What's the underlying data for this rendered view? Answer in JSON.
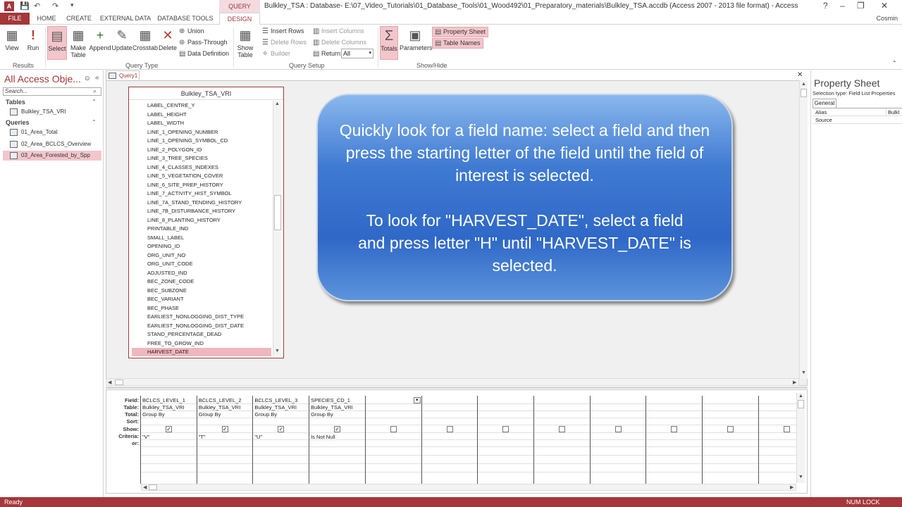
{
  "window": {
    "title": "Bulkley_TSA : Database- E:\\07_Video_Tutorials\\01_Database_Tools\\01_Wood492\\01_Preparatory_materials\\Bulkley_TSA.accdb (Access 2007 - 2013 file format) - Access",
    "contextual_tab": "QUERY TOOLS",
    "user": "Cosmin"
  },
  "tabs": [
    "FILE",
    "HOME",
    "CREATE",
    "EXTERNAL DATA",
    "DATABASE TOOLS",
    "DESIGN"
  ],
  "ribbon": {
    "results": {
      "label": "Results",
      "view": "View",
      "run": "Run"
    },
    "query_type": {
      "label": "Query Type",
      "select": "Select",
      "make_table": "Make Table",
      "append": "Append",
      "update": "Update",
      "crosstab": "Crosstab",
      "delete": "Delete",
      "union": "Union",
      "pass_through": "Pass-Through",
      "data_definition": "Data Definition"
    },
    "query_setup": {
      "label": "Query Setup",
      "show_table": "Show Table",
      "insert_rows": "Insert Rows",
      "delete_rows": "Delete Rows",
      "builder": "Builder",
      "insert_columns": "Insert Columns",
      "delete_columns": "Delete Columns",
      "return_label": "Return:",
      "return_value": "All"
    },
    "show_hide": {
      "label": "Show/Hide",
      "totals": "Totals",
      "parameters": "Parameters",
      "property_sheet": "Property Sheet",
      "table_names": "Table Names"
    }
  },
  "nav": {
    "title": "All Access Obje...",
    "search_placeholder": "Search...",
    "tables_header": "Tables",
    "tables": [
      "Bulkley_TSA_VRI"
    ],
    "queries_header": "Queries",
    "queries": [
      "01_Area_Total",
      "02_Area_BCLCS_Overview",
      "03_Area_Forested_by_Spp"
    ]
  },
  "document": {
    "tab": "Query1"
  },
  "field_list": {
    "title": "Bulkley_TSA_VRI",
    "fields": [
      "LABEL_CENTRE_Y",
      "LABEL_HEIGHT",
      "LABEL_WIDTH",
      "LINE_1_OPENING_NUMBER",
      "LINE_1_OPENING_SYMBOL_CD",
      "LINE_2_POLYGON_ID",
      "LINE_3_TREE_SPECIES",
      "LINE_4_CLASSES_INDEXES",
      "LINE_5_VEGETATION_COVER",
      "LINE_6_SITE_PREP_HISTORY",
      "LINE_7_ACTIVITY_HIST_SYMBOL",
      "LINE_7A_STAND_TENDING_HISTORY",
      "LINE_7B_DISTURBANCE_HISTORY",
      "LINE_8_PLANTING_HISTORY",
      "PRINTABLE_IND",
      "SMALL_LABEL",
      "OPENING_ID",
      "ORG_UNIT_NO",
      "ORG_UNIT_CODE",
      "ADJUSTED_IND",
      "BEC_ZONE_CODE",
      "BEC_SUBZONE",
      "BEC_VARIANT",
      "BEC_PHASE",
      "EARLIEST_NONLOGGING_DIST_TYPE",
      "EARLIEST_NONLOGGING_DIST_DATE",
      "STAND_PERCENTAGE_DEAD",
      "FREE_TO_GROW_IND",
      "HARVEST_DATE"
    ],
    "selected": "HARVEST_DATE"
  },
  "callout": {
    "para1": "Quickly look for a field name: select a field and then press the starting letter of the field until the field of interest is selected.",
    "para2": "To look for \"HARVEST_DATE\", select a field and press letter \"H\" until \"HARVEST_DATE\" is selected."
  },
  "grid": {
    "row_labels": [
      "Field:",
      "Table:",
      "Total:",
      "Sort:",
      "Show:",
      "Criteria:",
      "or:"
    ],
    "columns": [
      {
        "field": "BCLCS_LEVEL_1",
        "table": "Bulkley_TSA_VRI",
        "total": "Group By",
        "show": true,
        "criteria": "\"V\""
      },
      {
        "field": "BCLCS_LEVEL_2",
        "table": "Bulkley_TSA_VRI",
        "total": "Group By",
        "show": true,
        "criteria": "\"T\""
      },
      {
        "field": "BCLCS_LEVEL_3",
        "table": "Bulkley_TSA_VRI",
        "total": "Group By",
        "show": true,
        "criteria": "\"U\""
      },
      {
        "field": "SPECIES_CD_1",
        "table": "Bulkley_TSA_VRI",
        "total": "Group By",
        "show": true,
        "criteria": "Is Not Null"
      }
    ]
  },
  "property_sheet": {
    "title": "Property Sheet",
    "selection_type": "Selection type: Field List Properties",
    "tab": "General",
    "rows": [
      {
        "label": "Alias",
        "value": "Bulkl"
      },
      {
        "label": "Source",
        "value": ""
      }
    ]
  },
  "status": {
    "left": "Ready",
    "right": "NUM LOCK"
  },
  "colors": {
    "accent": "#a4373a",
    "callout": "#3f7ad2",
    "selection": "#f3c6cc"
  }
}
